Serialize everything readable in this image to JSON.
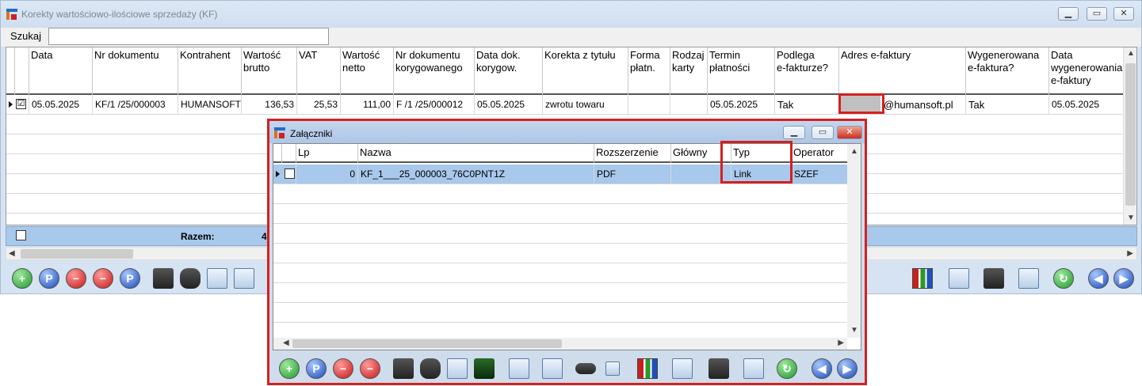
{
  "main": {
    "title": "Korekty wartościowo-ilościowe sprzedaży (KF)",
    "search_label": "Szukaj",
    "search_value": "",
    "columns": [
      "Data",
      "Nr dokumentu",
      "Kontrahent",
      "Wartość\nbrutto",
      "VAT",
      "Wartość\nnetto",
      "Nr dokumentu\nkorygowanego",
      "Data dok.\nkorygow.",
      "Korekta z tytułu",
      "Forma\npłatn.",
      "Rodzaj\nkarty",
      "Termin\npłatności",
      "Podlega\ne-fakturze?",
      "Adres e-faktury",
      "Wygenerowana\ne-faktura?",
      "Data\nwygenerowania\ne-faktury"
    ],
    "row": {
      "checked": "☑",
      "data": "05.05.2025",
      "nr_dokumentu": "KF/1 /25/000003",
      "kontrahent": "HUMANSOFT",
      "brutto": "136,53",
      "vat": "25,53",
      "netto": "111,00",
      "nr_korygowanego": "F /1 /25/000012",
      "data_korygow": "05.05.2025",
      "korekta_tytul": "zwrotu towaru",
      "forma": "",
      "rodzaj": "",
      "termin": "05.05.2025",
      "podlega": "Tak",
      "adres": "@humansoft.pl",
      "wygenerowana": "Tak",
      "data_wygen": "05.05.2025"
    },
    "totals_label": "Razem:",
    "totals_partial": "4"
  },
  "dialog": {
    "title": "Załączniki",
    "columns": [
      "Lp",
      "Nazwa",
      "Rozszerzenie",
      "Główny",
      "Typ",
      "Operator"
    ],
    "row": {
      "lp": "0",
      "nazwa": "KF_1___25_000003_76C0PNT1Z",
      "rozszerzenie": "PDF",
      "glowny": "",
      "typ": "Link",
      "operator": "SZEF"
    }
  },
  "colors": {
    "accent_red": "#d42020",
    "selection_blue": "#a8c8ec"
  }
}
